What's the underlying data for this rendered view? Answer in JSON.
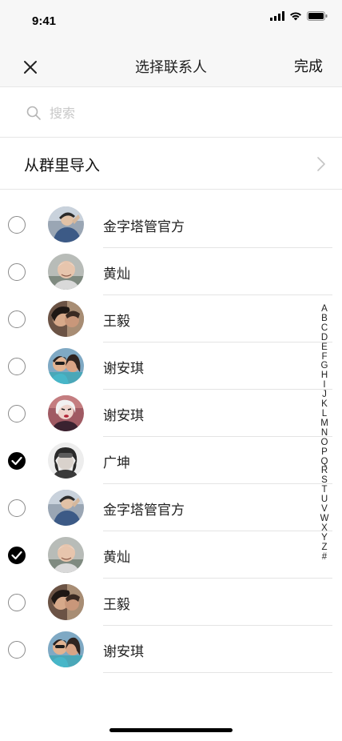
{
  "status_bar": {
    "time": "9:41",
    "icons": [
      "cellular-signal-icon",
      "wifi-icon",
      "battery-icon"
    ]
  },
  "nav": {
    "close_icon": "close-icon",
    "title": "选择联系人",
    "done_label": "完成"
  },
  "search": {
    "placeholder": "搜索",
    "value": ""
  },
  "group_import": {
    "label": "从群里导入"
  },
  "contacts": [
    {
      "name": "金字塔管官方",
      "checked": false,
      "avatar": "a"
    },
    {
      "name": "黄灿",
      "checked": false,
      "avatar": "b"
    },
    {
      "name": "王毅",
      "checked": false,
      "avatar": "c"
    },
    {
      "name": "谢安琪",
      "checked": false,
      "avatar": "d"
    },
    {
      "name": "谢安琪",
      "checked": false,
      "avatar": "e"
    },
    {
      "name": "广坤",
      "checked": true,
      "avatar": "f"
    },
    {
      "name": "金字塔管官方",
      "checked": false,
      "avatar": "a"
    },
    {
      "name": "黄灿",
      "checked": true,
      "avatar": "b"
    },
    {
      "name": "王毅",
      "checked": false,
      "avatar": "c"
    },
    {
      "name": "谢安琪",
      "checked": false,
      "avatar": "d"
    }
  ],
  "alpha_index": [
    "A",
    "B",
    "C",
    "D",
    "E",
    "F",
    "G",
    "H",
    "I",
    "J",
    "K",
    "L",
    "M",
    "N",
    "O",
    "P",
    "Q",
    "R",
    "S",
    "T",
    "U",
    "V",
    "W",
    "X",
    "Y",
    "Z",
    "#"
  ],
  "colors": {
    "header_bg": "#f7f7f7",
    "checked": "#000000",
    "placeholder": "#c8c8c8"
  }
}
